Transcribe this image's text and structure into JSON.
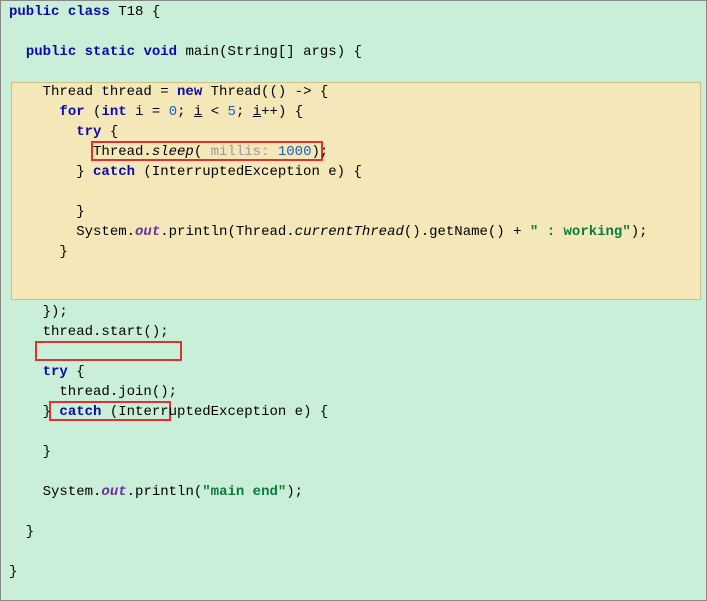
{
  "code": {
    "l0_a": "public",
    "l0_b": "class",
    "l0_c": " T18 {",
    "l2_a": "public",
    "l2_b": "static",
    "l2_c": "void",
    "l2_d": " main(String[] args) {",
    "l4_a": "    Thread thread = ",
    "l4_b": "new",
    "l4_c": " Thread(() -> {",
    "l5_a": "for",
    "l5_b": " (",
    "l5_c": "int",
    "l5_d": " i = ",
    "l5_e": "0",
    "l5_f": "; ",
    "l5_g": "i",
    "l5_h": " < ",
    "l5_i": "5",
    "l5_j": "; ",
    "l5_k": "i",
    "l5_l": "++) {",
    "l6_a": "try",
    "l6_b": " {",
    "l7_a": "          Thread.",
    "l7_b": "sleep",
    "l7_c": "( ",
    "l7_hint": "millis:",
    "l7_d": " ",
    "l7_num": "1000",
    "l7_e": ");",
    "l8_a": "        } ",
    "l8_b": "catch",
    "l8_c": " (InterruptedException e) {",
    "l10_a": "        }",
    "l11_a": "        System.",
    "l11_b": "out",
    "l11_c": ".println(Thread.",
    "l11_d": "currentThread",
    "l11_e": "().getName() + ",
    "l11_f": "\" : working\"",
    "l11_g": ");",
    "l12_a": "      }",
    "l15_a": "    });",
    "l16_a": "    thread.start();",
    "l18_a": "try",
    "l18_b": " {",
    "l19_a": "      thread.join();",
    "l20_a": "    } ",
    "l20_b": "catch",
    "l20_c": " (InterruptedException e) {",
    "l22_a": "    }",
    "l24_a": "    System.",
    "l24_b": "out",
    "l24_c": ".println(",
    "l24_d": "\"main end\"",
    "l24_e": ");",
    "l26_a": "  }",
    "l28_a": "}"
  }
}
